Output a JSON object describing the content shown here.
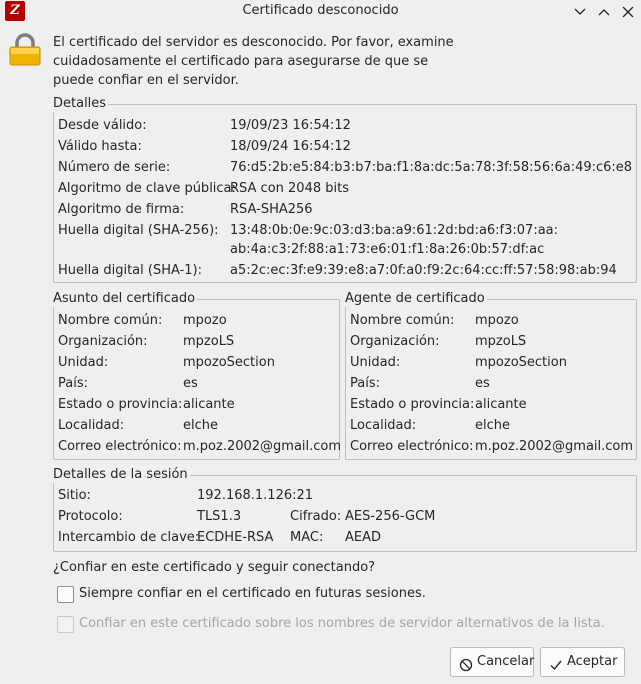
{
  "window": {
    "app_icon_text": "Z",
    "title": "Certificado desconocido"
  },
  "intro_text": "El certificado del servidor es desconocido. Por favor, examine cuidadosamente el certificado para asegurarse de que se puede confiar en el servidor.",
  "details": {
    "title": "Detalles",
    "rows": [
      {
        "label": "Desde válido:",
        "value": "19/09/23 16:54:12"
      },
      {
        "label": "Válido hasta:",
        "value": "18/09/24 16:54:12"
      },
      {
        "label": "Número de serie:",
        "value": "76:d5:2b:e5:84:b3:b7:ba:f1:8a:dc:5a:78:3f:58:56:6a:49:c6:e8"
      },
      {
        "label": "Algoritmo de clave pública:",
        "value": "RSA con 2048 bits"
      },
      {
        "label": "Algoritmo de firma:",
        "value": "RSA-SHA256"
      },
      {
        "label": "Huella digital (SHA-256):",
        "value": "13:48:0b:0e:9c:03:d3:ba:a9:61:2d:bd:a6:f3:07:aa:",
        "value2": "ab:4a:c3:2f:88:a1:73:e6:01:f1:8a:26:0b:57:df:ac"
      },
      {
        "label": "Huella digital (SHA-1):",
        "value": "a5:2c:ec:3f:e9:39:e8:a7:0f:a0:f9:2c:64:cc:ff:57:58:98:ab:94"
      }
    ]
  },
  "subject": {
    "title": "Asunto del certificado",
    "rows": [
      {
        "label": "Nombre común:",
        "value": "mpozo"
      },
      {
        "label": "Organización:",
        "value": "mpzoLS"
      },
      {
        "label": "Unidad:",
        "value": "mpozoSection"
      },
      {
        "label": "País:",
        "value": "es"
      },
      {
        "label": "Estado o provincia:",
        "value": "alicante"
      },
      {
        "label": "Localidad:",
        "value": "elche"
      },
      {
        "label": "Correo electrónico:",
        "value": "m.poz.2002@gmail.com"
      }
    ]
  },
  "issuer": {
    "title": "Agente de certificado",
    "rows": [
      {
        "label": "Nombre común:",
        "value": "mpozo"
      },
      {
        "label": "Organización:",
        "value": "mpzoLS"
      },
      {
        "label": "Unidad:",
        "value": "mpozoSection"
      },
      {
        "label": "País:",
        "value": "es"
      },
      {
        "label": "Estado o provincia:",
        "value": "alicante"
      },
      {
        "label": "Localidad:",
        "value": "elche"
      },
      {
        "label": "Correo electrónico:",
        "value": "m.poz.2002@gmail.com"
      }
    ]
  },
  "session": {
    "title": "Detalles de la sesión",
    "host_label": "Sitio:",
    "host_value": "192.168.1.126:21",
    "protocol_label": "Protocolo:",
    "protocol_value": "TLS1.3",
    "cipher_label": "Cifrado:",
    "cipher_value": "AES-256-GCM",
    "kex_label": "Intercambio de clave:",
    "kex_value": "ECDHE-RSA",
    "mac_label": "MAC:",
    "mac_value": "AEAD"
  },
  "question": "¿Confiar en este certificado y seguir conectando?",
  "always_trust": {
    "label": "Siempre confiar en el certificado en futuras sesiones.",
    "checked": false
  },
  "trust_altnames": {
    "label": "Confiar en este certificado sobre los nombres de servidor alternativos de la lista.",
    "checked": false,
    "disabled": true
  },
  "buttons": {
    "cancel": "Cancelar",
    "accept": "Aceptar"
  },
  "colors": {
    "lock_body": "#f0b400",
    "accept_check": "#232629"
  }
}
